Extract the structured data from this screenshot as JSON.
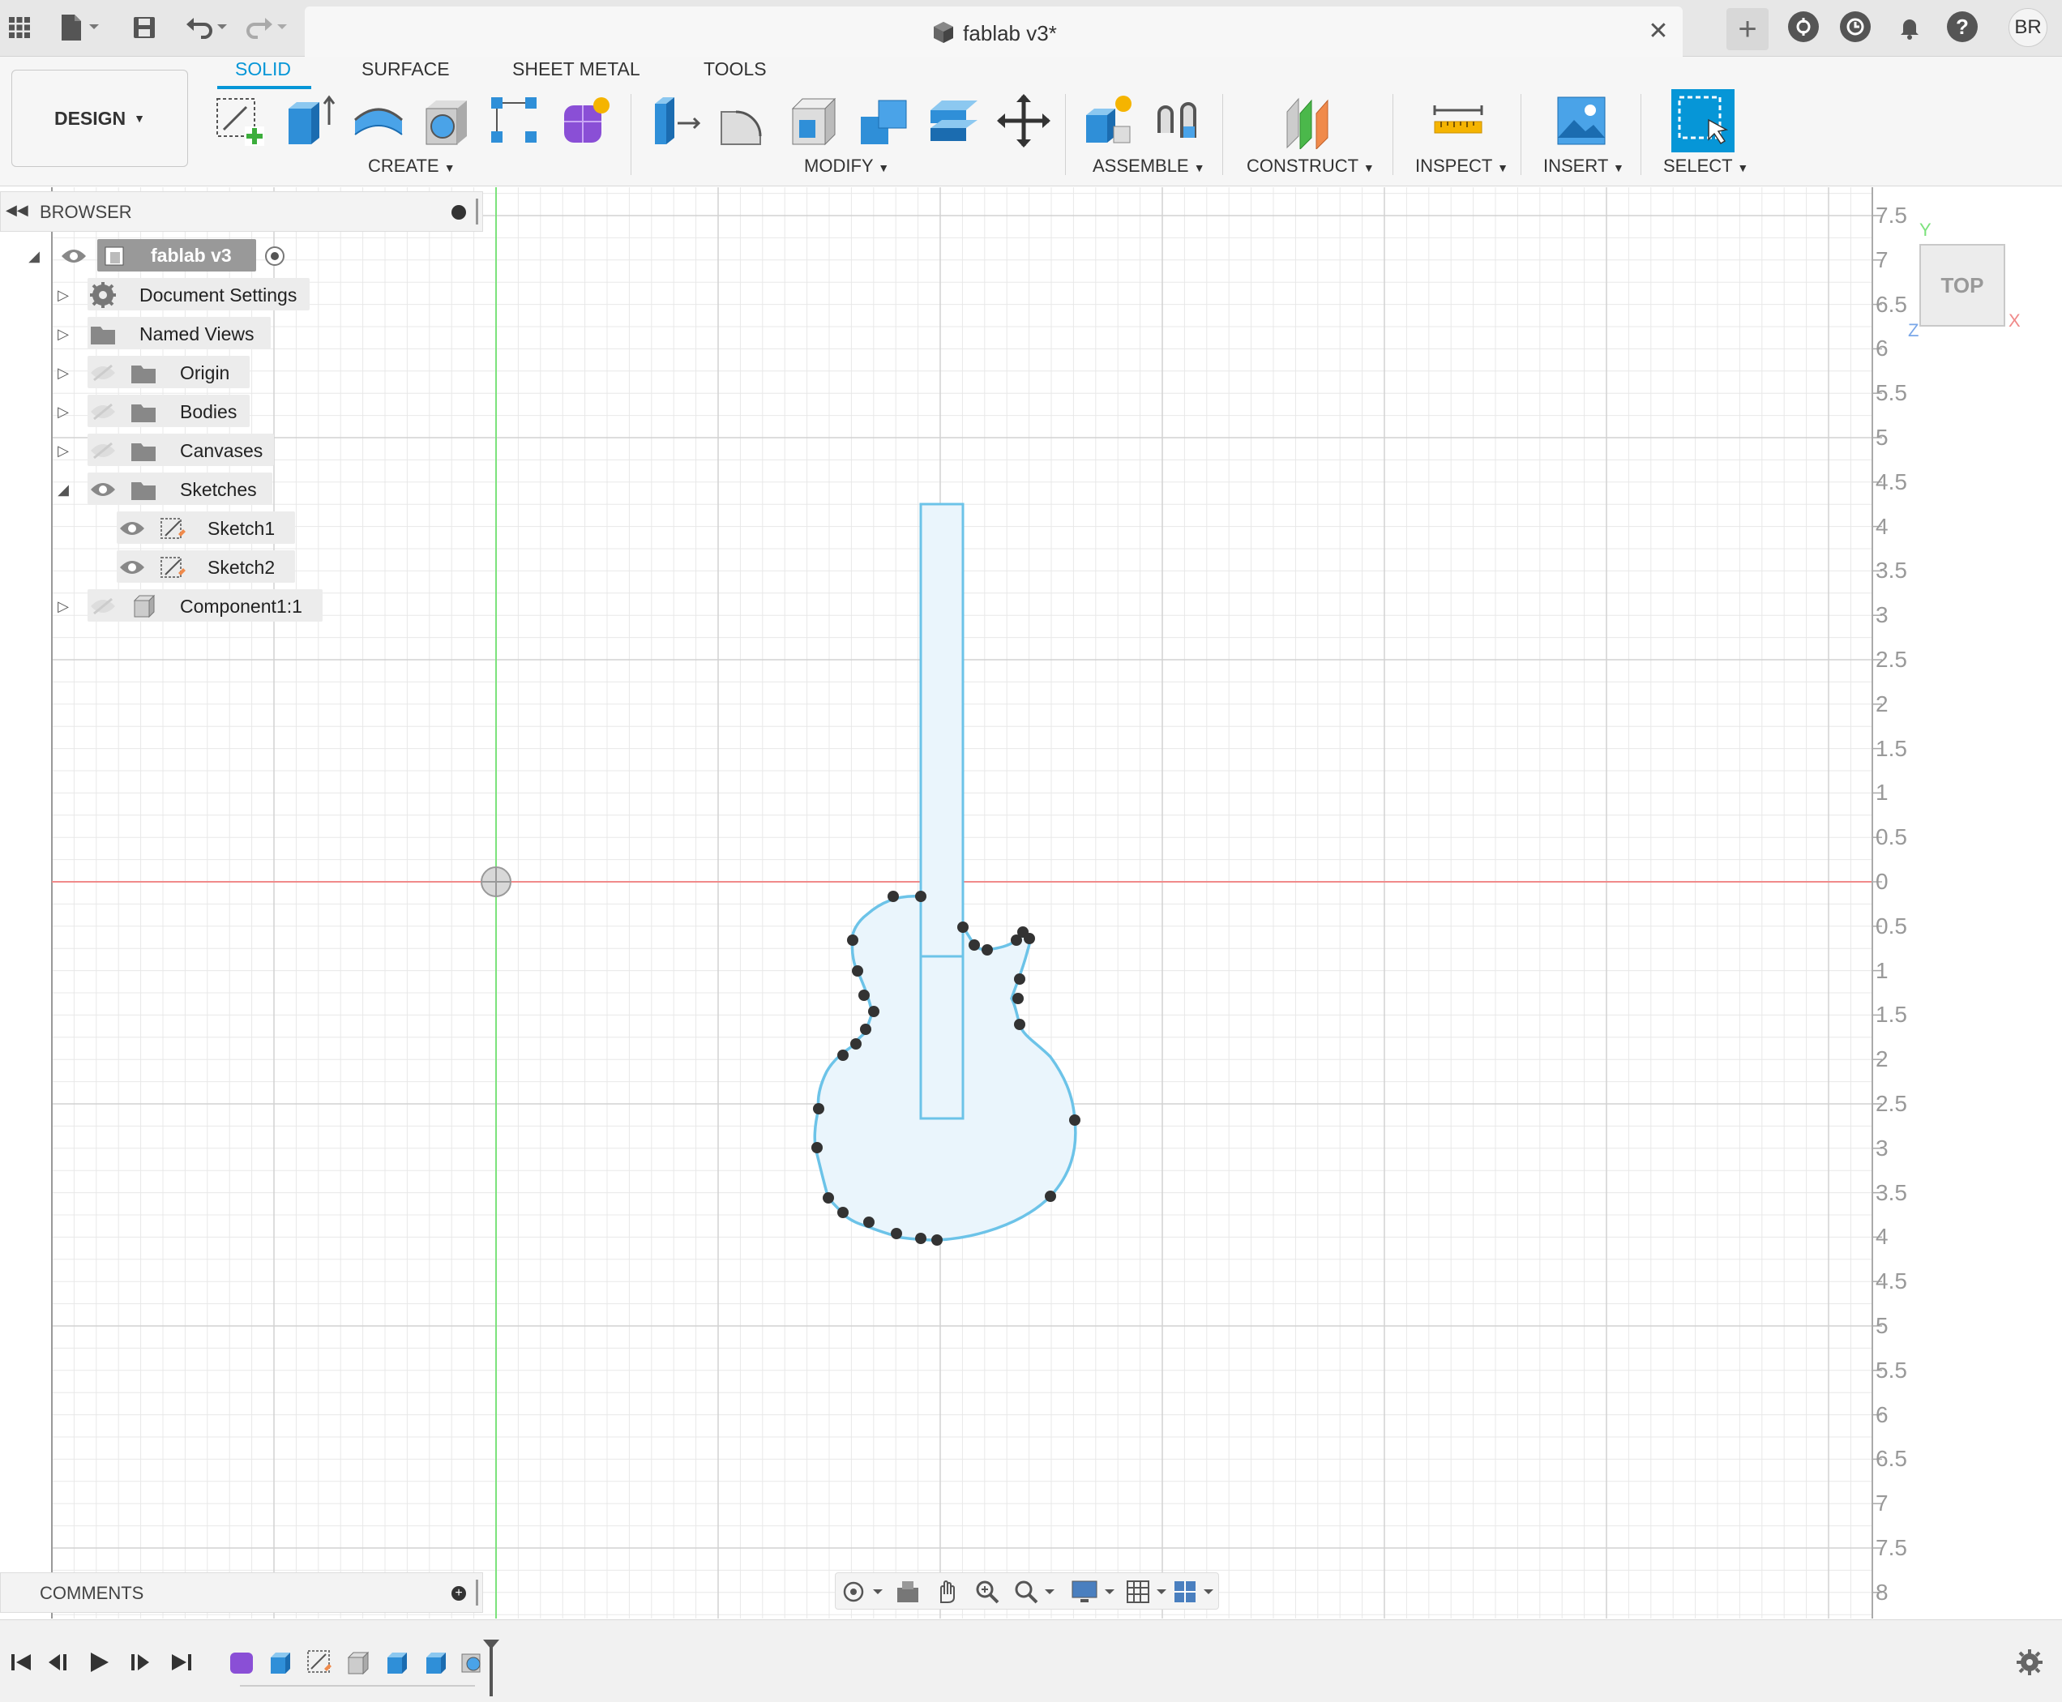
{
  "window": {
    "title": "fablab v3*"
  },
  "topbar": {
    "avatar_initials": "BR",
    "icons": [
      "apps-grid-icon",
      "file-icon",
      "save-icon",
      "undo-icon",
      "redo-icon",
      "new-tab-icon",
      "extensions-icon",
      "job-status-icon",
      "notifications-icon",
      "help-icon"
    ]
  },
  "ribbon": {
    "workspace_label": "DESIGN",
    "tabs": [
      {
        "label": "SOLID",
        "active": true
      },
      {
        "label": "SURFACE",
        "active": false
      },
      {
        "label": "SHEET METAL",
        "active": false
      },
      {
        "label": "TOOLS",
        "active": false
      }
    ],
    "groups": {
      "create": "CREATE",
      "modify": "MODIFY",
      "assemble": "ASSEMBLE",
      "construct": "CONSTRUCT",
      "inspect": "INSPECT",
      "insert": "INSERT",
      "select": "SELECT"
    }
  },
  "browser": {
    "title": "BROWSER",
    "root": "fablab v3",
    "items": [
      {
        "label": "Document Settings",
        "icon": "gear-icon"
      },
      {
        "label": "Named Views",
        "icon": "folder-icon"
      },
      {
        "label": "Origin",
        "icon": "folder-icon"
      },
      {
        "label": "Bodies",
        "icon": "folder-icon"
      },
      {
        "label": "Canvases",
        "icon": "folder-icon"
      },
      {
        "label": "Sketches",
        "icon": "folder-icon"
      },
      {
        "label": "Sketch1",
        "icon": "sketch-icon"
      },
      {
        "label": "Sketch2",
        "icon": "sketch-icon"
      },
      {
        "label": "Component1:1",
        "icon": "component-icon"
      }
    ]
  },
  "comments": {
    "title": "COMMENTS"
  },
  "viewcube": {
    "face": "TOP",
    "axes": [
      "Y",
      "X",
      "Z"
    ]
  },
  "ruler": {
    "labels": [
      "7.5",
      "7",
      "6.5",
      "6",
      "5.5",
      "5",
      "4.5",
      "4",
      "3.5",
      "3",
      "2.5",
      "2",
      "1.5",
      "1",
      "0.5",
      "0",
      "0.5",
      "1",
      "1.5",
      "2",
      "2.5",
      "3",
      "3.5",
      "4",
      "4.5",
      "5",
      "5.5",
      "6",
      "6.5",
      "7",
      "7.5",
      "8"
    ]
  }
}
